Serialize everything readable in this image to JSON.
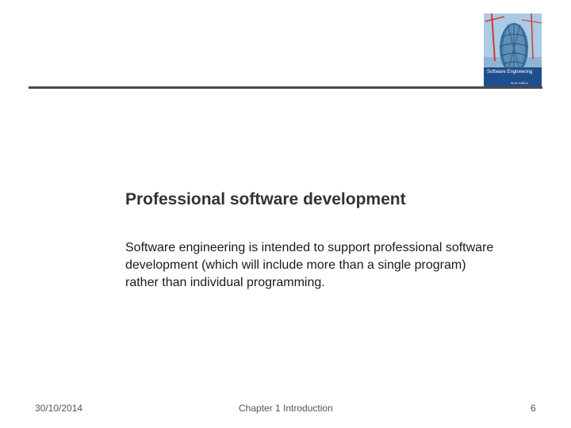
{
  "cover": {
    "title": "Software Engineering",
    "edition": "tenth edition"
  },
  "slide": {
    "heading": "Professional software development",
    "body": "Software engineering is intended to support professional software development (which will include more than a single program) rather than individual programming."
  },
  "footer": {
    "date": "30/10/2014",
    "chapter": "Chapter 1 Introduction",
    "page": "6"
  },
  "colors": {
    "rule": "#4a4a4a",
    "heading": "#333333",
    "cover_sky": "#9fc3e0",
    "cover_band": "#1f4e8c"
  }
}
